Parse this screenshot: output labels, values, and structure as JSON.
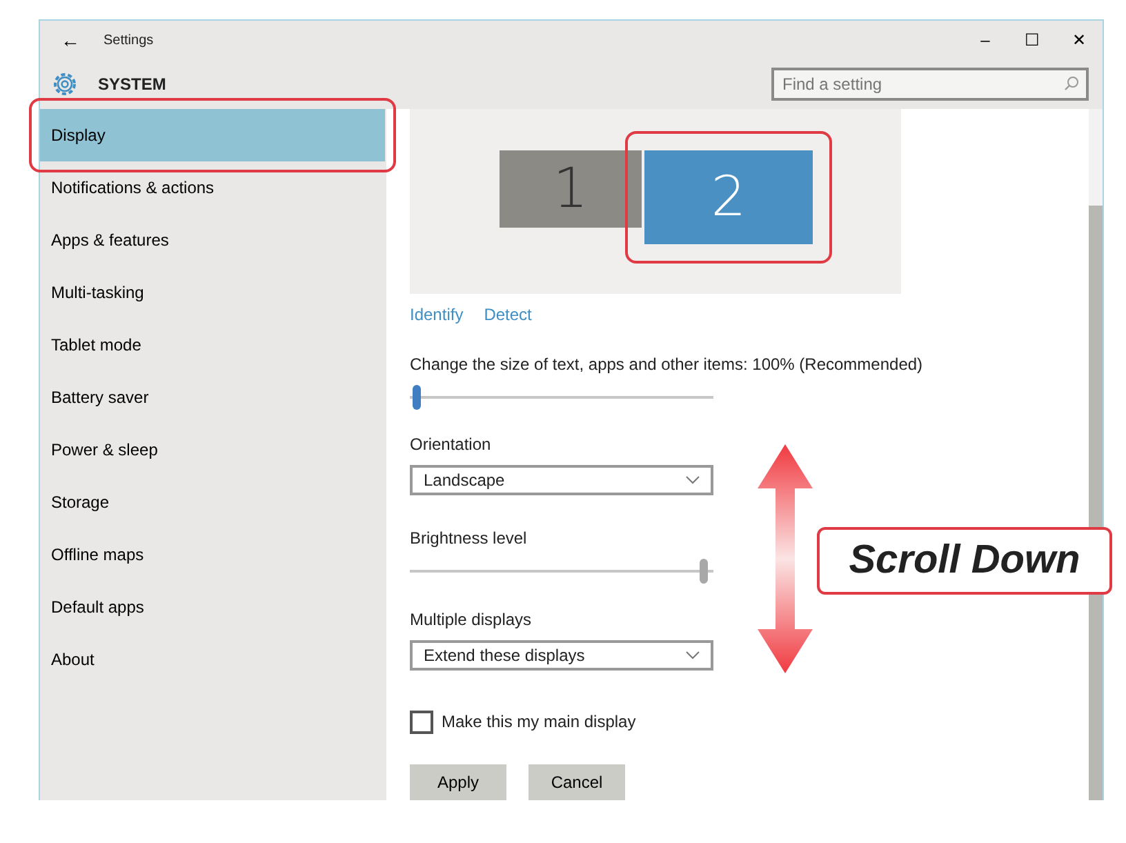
{
  "window": {
    "title": "Settings",
    "back": "←",
    "controls": [
      "–",
      "☐",
      "✕"
    ]
  },
  "header": {
    "title": "SYSTEM",
    "search": {
      "placeholder": "Find a setting"
    }
  },
  "sidebar": {
    "items": [
      {
        "label": "Display",
        "selected": true,
        "highlighted": true
      },
      {
        "label": "Notifications & actions",
        "selected": false,
        "highlighted": false
      },
      {
        "label": "Apps & features",
        "selected": false,
        "highlighted": false
      },
      {
        "label": "Multi-tasking",
        "selected": false,
        "highlighted": false
      },
      {
        "label": "Tablet mode",
        "selected": false,
        "highlighted": false
      },
      {
        "label": "Battery saver",
        "selected": false,
        "highlighted": false
      },
      {
        "label": "Power & sleep",
        "selected": false,
        "highlighted": false
      },
      {
        "label": "Storage",
        "selected": false,
        "highlighted": false
      },
      {
        "label": "Offline maps",
        "selected": false,
        "highlighted": false
      },
      {
        "label": "Default apps",
        "selected": false,
        "highlighted": false
      },
      {
        "label": "About",
        "selected": false,
        "highlighted": false
      }
    ]
  },
  "content": {
    "monitors": [
      {
        "label": "1",
        "selected": false,
        "highlighted": false
      },
      {
        "label": "2",
        "selected": true,
        "highlighted": true
      }
    ],
    "links": [
      "Identify",
      "Detect"
    ],
    "controls": [
      {
        "kind": "slider",
        "label": "Change the size of text, apps and other items: 100% (Recommended)",
        "level": 0.01,
        "accent": true
      },
      {
        "kind": "dropdown",
        "label": "Orientation",
        "value": "Landscape"
      },
      {
        "kind": "slider",
        "label": "Brightness level",
        "level": 0.98,
        "accent": false
      },
      {
        "kind": "dropdown",
        "label": "Multiple displays",
        "value": "Extend these displays"
      },
      {
        "kind": "checkbox",
        "label": "Make this my main display",
        "checked": false
      }
    ],
    "buttons": [
      "Apply",
      "Cancel"
    ]
  },
  "annotation": {
    "callout": "Scroll Down"
  }
}
